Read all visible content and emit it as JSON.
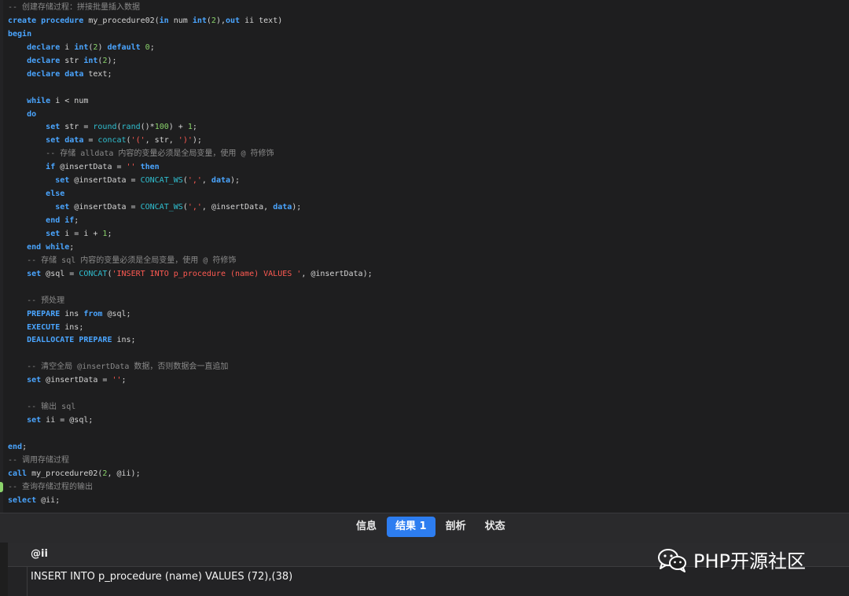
{
  "editor": {
    "lines": [
      [
        [
          "-- 创建存储过程：拼接批量插入数据",
          "c"
        ]
      ],
      [
        [
          "create procedure",
          "k"
        ],
        [
          " my_procedure02(",
          ""
        ],
        [
          "in",
          "k"
        ],
        [
          " num ",
          ""
        ],
        [
          "int",
          "k"
        ],
        [
          "(",
          ""
        ],
        [
          "2",
          "n"
        ],
        [
          "),",
          ""
        ],
        [
          "out",
          "k"
        ],
        [
          " ii text)",
          ""
        ]
      ],
      [
        [
          "begin",
          "k"
        ]
      ],
      [
        [
          "    ",
          ""
        ],
        [
          "declare",
          "k"
        ],
        [
          " i ",
          ""
        ],
        [
          "int",
          "k"
        ],
        [
          "(",
          ""
        ],
        [
          "2",
          "n"
        ],
        [
          ") ",
          ""
        ],
        [
          "default",
          "k"
        ],
        [
          " ",
          ""
        ],
        [
          "0",
          "n"
        ],
        [
          ";",
          ""
        ]
      ],
      [
        [
          "    ",
          ""
        ],
        [
          "declare",
          "k"
        ],
        [
          " str ",
          ""
        ],
        [
          "int",
          "k"
        ],
        [
          "(",
          ""
        ],
        [
          "2",
          "n"
        ],
        [
          ");",
          ""
        ]
      ],
      [
        [
          "    ",
          ""
        ],
        [
          "declare",
          "k"
        ],
        [
          " ",
          ""
        ],
        [
          "data",
          "k"
        ],
        [
          " text;",
          ""
        ]
      ],
      [
        [
          "",
          ""
        ]
      ],
      [
        [
          "    ",
          ""
        ],
        [
          "while",
          "k"
        ],
        [
          " i < num",
          ""
        ]
      ],
      [
        [
          "    ",
          ""
        ],
        [
          "do",
          "k"
        ]
      ],
      [
        [
          "        ",
          ""
        ],
        [
          "set",
          "k"
        ],
        [
          " str = ",
          ""
        ],
        [
          "round",
          "f"
        ],
        [
          "(",
          ""
        ],
        [
          "rand",
          "f"
        ],
        [
          "()*",
          ""
        ],
        [
          "100",
          "n"
        ],
        [
          ") + ",
          ""
        ],
        [
          "1",
          "n"
        ],
        [
          ";",
          ""
        ]
      ],
      [
        [
          "        ",
          ""
        ],
        [
          "set",
          "k"
        ],
        [
          " ",
          ""
        ],
        [
          "data",
          "k"
        ],
        [
          " = ",
          ""
        ],
        [
          "concat",
          "f"
        ],
        [
          "(",
          ""
        ],
        [
          "'('",
          "s"
        ],
        [
          ", str, ",
          ""
        ],
        [
          "')'",
          "s"
        ],
        [
          ");",
          ""
        ]
      ],
      [
        [
          "        ",
          ""
        ],
        [
          "-- 存储 alldata 内容的变量必须是全局变量，使用 @ 符修饰",
          "c"
        ]
      ],
      [
        [
          "        ",
          ""
        ],
        [
          "if",
          "k"
        ],
        [
          " @insertData = ",
          ""
        ],
        [
          "''",
          "s"
        ],
        [
          " ",
          ""
        ],
        [
          "then",
          "k"
        ]
      ],
      [
        [
          "          ",
          ""
        ],
        [
          "set",
          "k"
        ],
        [
          " @insertData = ",
          ""
        ],
        [
          "CONCAT_WS",
          "f"
        ],
        [
          "(",
          ""
        ],
        [
          "','",
          "s"
        ],
        [
          ", ",
          ""
        ],
        [
          "data",
          "k"
        ],
        [
          ");",
          ""
        ]
      ],
      [
        [
          "        ",
          ""
        ],
        [
          "else",
          "k"
        ]
      ],
      [
        [
          "          ",
          ""
        ],
        [
          "set",
          "k"
        ],
        [
          " @insertData = ",
          ""
        ],
        [
          "CONCAT_WS",
          "f"
        ],
        [
          "(",
          ""
        ],
        [
          "','",
          "s"
        ],
        [
          ", @insertData, ",
          ""
        ],
        [
          "data",
          "k"
        ],
        [
          ");",
          ""
        ]
      ],
      [
        [
          "        ",
          ""
        ],
        [
          "end if",
          "k"
        ],
        [
          ";",
          ""
        ]
      ],
      [
        [
          "        ",
          ""
        ],
        [
          "set",
          "k"
        ],
        [
          " i = i + ",
          ""
        ],
        [
          "1",
          "n"
        ],
        [
          ";",
          ""
        ]
      ],
      [
        [
          "    ",
          ""
        ],
        [
          "end while",
          "k"
        ],
        [
          ";",
          ""
        ]
      ],
      [
        [
          "    ",
          ""
        ],
        [
          "-- 存储 sql 内容的变量必须是全局变量，使用 @ 符修饰",
          "c"
        ]
      ],
      [
        [
          "    ",
          ""
        ],
        [
          "set",
          "k"
        ],
        [
          " @sql = ",
          ""
        ],
        [
          "CONCAT",
          "f"
        ],
        [
          "(",
          ""
        ],
        [
          "'INSERT INTO p_procedure (name) VALUES '",
          "s"
        ],
        [
          ", @insertData);",
          ""
        ]
      ],
      [
        [
          "",
          ""
        ]
      ],
      [
        [
          "    ",
          ""
        ],
        [
          "-- 预处理",
          "c"
        ]
      ],
      [
        [
          "    ",
          ""
        ],
        [
          "PREPARE",
          "k"
        ],
        [
          " ins ",
          ""
        ],
        [
          "from",
          "k"
        ],
        [
          " @sql;",
          ""
        ]
      ],
      [
        [
          "    ",
          ""
        ],
        [
          "EXECUTE",
          "k"
        ],
        [
          " ins;",
          ""
        ]
      ],
      [
        [
          "    ",
          ""
        ],
        [
          "DEALLOCATE PREPARE",
          "k"
        ],
        [
          " ins;",
          ""
        ]
      ],
      [
        [
          "",
          ""
        ]
      ],
      [
        [
          "    ",
          ""
        ],
        [
          "-- 清空全局 @insertData 数据，否则数据会一直追加",
          "c"
        ]
      ],
      [
        [
          "    ",
          ""
        ],
        [
          "set",
          "k"
        ],
        [
          " @insertData = ",
          ""
        ],
        [
          "''",
          "s"
        ],
        [
          ";",
          ""
        ]
      ],
      [
        [
          "",
          ""
        ]
      ],
      [
        [
          "    ",
          ""
        ],
        [
          "-- 输出 sql",
          "c"
        ]
      ],
      [
        [
          "    ",
          ""
        ],
        [
          "set",
          "k"
        ],
        [
          " ii = @sql;",
          ""
        ]
      ],
      [
        [
          "",
          ""
        ]
      ],
      [
        [
          "end",
          "k"
        ],
        [
          ";",
          ""
        ]
      ],
      [
        [
          "-- 调用存储过程",
          "c"
        ]
      ],
      [
        [
          "call",
          "k"
        ],
        [
          " my_procedure02(",
          ""
        ],
        [
          "2",
          "n"
        ],
        [
          ", @ii);",
          ""
        ]
      ],
      [
        [
          "-- 查询存储过程的输出",
          "c"
        ]
      ],
      [
        [
          "select",
          "k"
        ],
        [
          " @ii;",
          ""
        ]
      ]
    ]
  },
  "tabs": [
    {
      "label": "信息",
      "active": false
    },
    {
      "label": "结果 1",
      "active": true
    },
    {
      "label": "剖析",
      "active": false
    },
    {
      "label": "状态",
      "active": false
    }
  ],
  "results": {
    "column_header": "@ii",
    "cell_value": "INSERT INTO p_procedure (name) VALUES (72),(38)"
  },
  "watermark": {
    "text": "PHP开源社区",
    "icon": "wechat-icon"
  },
  "colors": {
    "keyword": "#4aa5ff",
    "comment": "#8a8a8a",
    "string": "#ff5a52",
    "number": "#8ad36b",
    "function": "#30bfd0",
    "active_tab": "#2d7df0"
  }
}
